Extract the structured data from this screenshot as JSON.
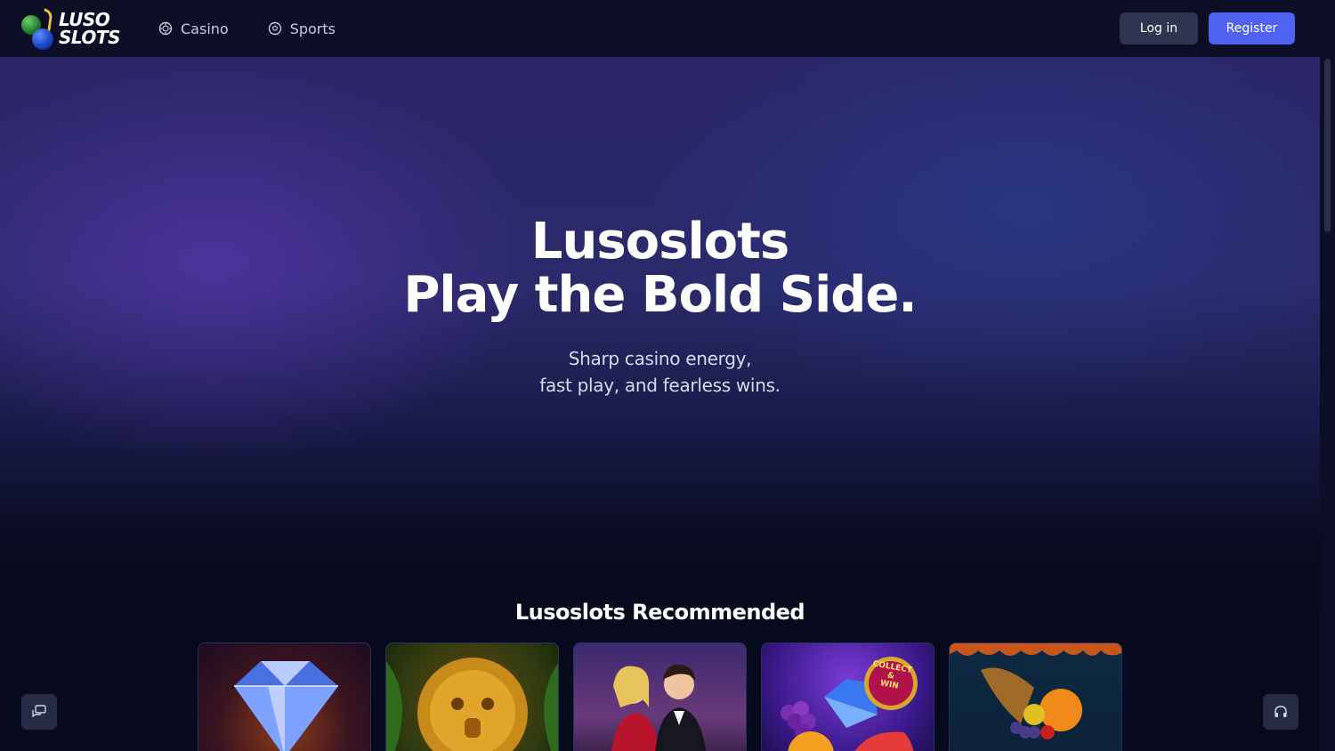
{
  "header": {
    "logo": {
      "line1": "LUSO",
      "line2": "SLOTS"
    },
    "nav": [
      {
        "label": "Casino",
        "icon": "casino-chip-icon"
      },
      {
        "label": "Sports",
        "icon": "soccer-ball-icon"
      }
    ],
    "login_label": "Log in",
    "register_label": "Register"
  },
  "hero": {
    "title_line1": "Lusoslots",
    "title_line2": "Play the Bold Side.",
    "subtitle_line1": "Sharp casino energy,",
    "subtitle_line2": "fast play, and fearless wins."
  },
  "recommended": {
    "title": "Lusoslots Recommended",
    "games": [
      {
        "icon": "diamond-icon"
      },
      {
        "icon": "aztec-mask-icon"
      },
      {
        "icon": "couple-icon"
      },
      {
        "icon": "fruits-icon",
        "badge_line1": "COLLECT",
        "badge_line2": "&",
        "badge_line3": "WIN"
      },
      {
        "icon": "cornucopia-icon"
      }
    ]
  },
  "floating": {
    "left_icon": "chat-icon",
    "right_icon": "headset-icon"
  },
  "colors": {
    "header_bg": "#0b0e24",
    "register_bg": "#4f63f0",
    "login_bg": "#2f3550",
    "page_bg": "#070a1c"
  }
}
